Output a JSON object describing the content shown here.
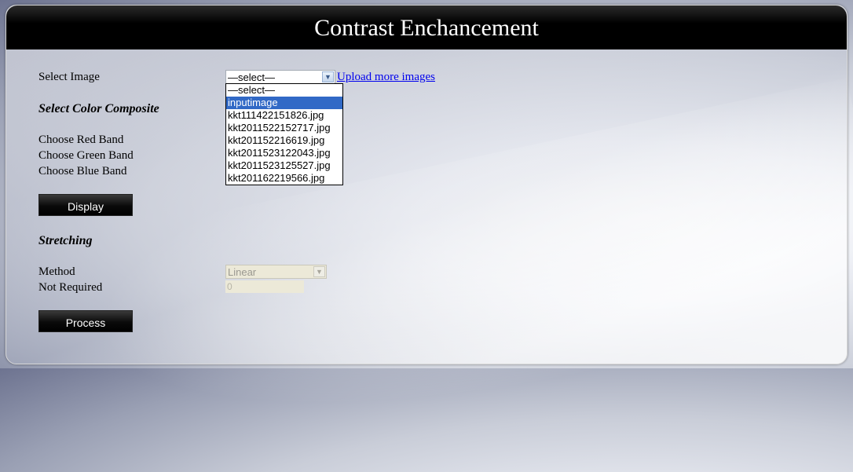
{
  "header": {
    "title": "Contrast Enchancement"
  },
  "select_image": {
    "label": "Select Image",
    "selected_value": "—select—",
    "upload_link": "Upload more images",
    "options": [
      "—select—",
      "inputimage",
      "kkt111422151826.jpg",
      "kkt2011522152717.jpg",
      "kkt201152216619.jpg",
      "kkt2011523122043.jpg",
      "kkt2011523125527.jpg",
      "kkt201162219566.jpg"
    ],
    "highlighted_option": "inputimage"
  },
  "color_composite": {
    "heading": "Select Color Composite",
    "red_label": "Choose Red Band",
    "green_label": "Choose Green Band",
    "blue_label": "Choose Blue Band",
    "display_button": "Display"
  },
  "stretching": {
    "heading": "Stretching",
    "method_label": "Method",
    "method_value": "Linear",
    "not_required_label": "Not Required",
    "not_required_value": "0",
    "process_button": "Process"
  }
}
